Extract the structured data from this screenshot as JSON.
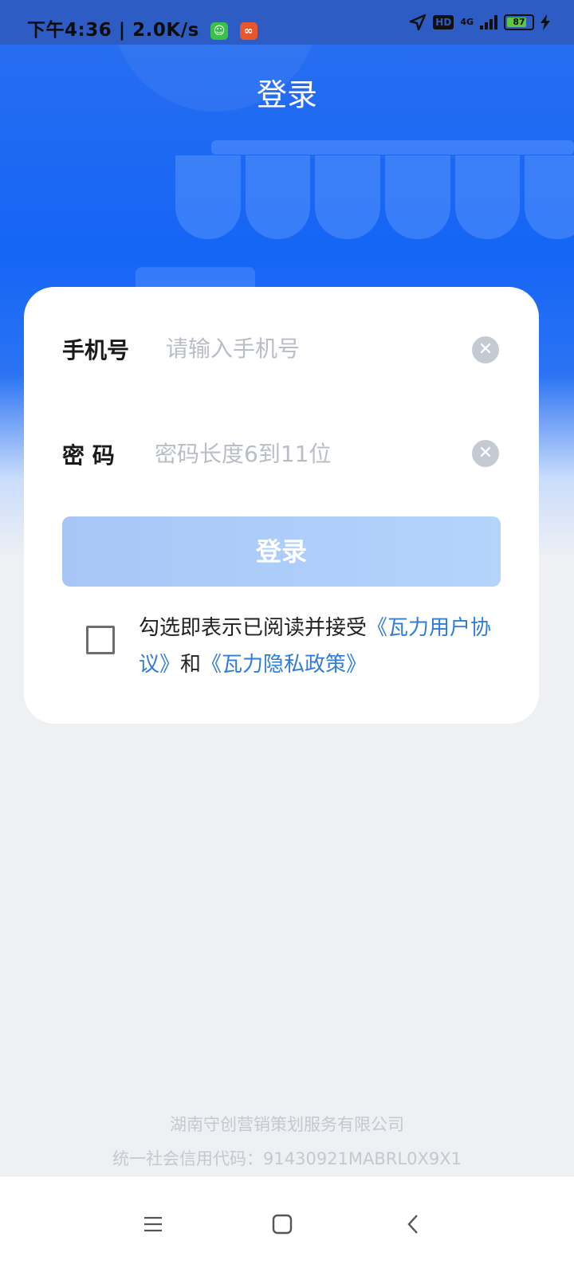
{
  "status_bar": {
    "time_speed": "下午4:36 | 2.0K/s",
    "network": "4G",
    "battery": "87"
  },
  "header": {
    "title": "登录"
  },
  "form": {
    "phone_label": "手机号",
    "phone_placeholder": "请输入手机号",
    "password_label": "密 码",
    "password_placeholder": "密码长度6到11位",
    "login_button": "登录"
  },
  "agreement": {
    "checked": false,
    "text_prefix": "勾选即表示已阅读并接受",
    "user_agreement_link": "《瓦力用户协议》",
    "conjunction": "和",
    "privacy_policy_link": "《瓦力隐私政策》"
  },
  "footer": {
    "company": "湖南守创营销策划服务有限公司",
    "credit_code": "统一社会信用代码：91430921MABRL0X9X1"
  },
  "nav": [
    "menu-icon",
    "home-icon",
    "back-icon"
  ],
  "colors": {
    "primary": "#1565f5",
    "button_disabled": "#a7c6f7",
    "link": "#2f7dd9"
  }
}
